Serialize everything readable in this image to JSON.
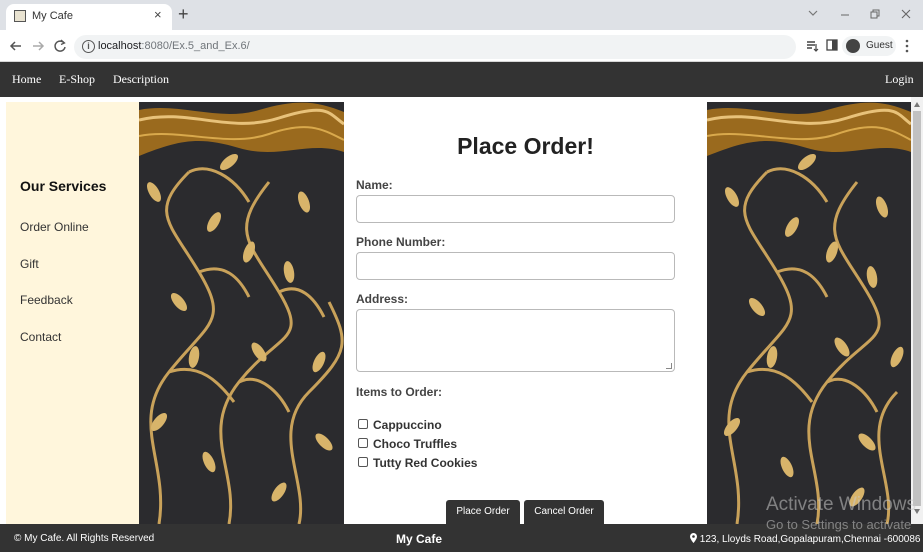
{
  "browser": {
    "tab_title": "My Cafe",
    "tab_close": "×",
    "new_tab": "+",
    "url_host": "localhost",
    "url_path": ":8080/Ex.5_and_Ex.6/",
    "profile_label": "Guest",
    "icons": {
      "back": "back-arrow-icon",
      "forward": "forward-arrow-icon",
      "reload": "reload-icon",
      "info": "info-icon",
      "reading_list": "reading-list-icon",
      "side_panel": "side-panel-icon",
      "menu": "kebab-menu-icon"
    }
  },
  "nav": {
    "links": [
      "Home",
      "E-Shop",
      "Description"
    ],
    "login": "Login"
  },
  "sidebar": {
    "heading": "Our Services",
    "items": [
      "Order Online",
      "Gift",
      "Feedback",
      "Contact"
    ]
  },
  "form": {
    "title": "Place Order!",
    "name_label": "Name:",
    "name_value": "",
    "phone_label": "Phone Number:",
    "phone_value": "",
    "address_label": "Address:",
    "address_value": "",
    "items_label": "Items to Order:",
    "items": [
      {
        "label": "Cappuccino",
        "checked": false
      },
      {
        "label": "Choco Truffles",
        "checked": false
      },
      {
        "label": "Tutty Red Cookies",
        "checked": false
      }
    ],
    "submit_label": "Place Order",
    "cancel_label": "Cancel Order"
  },
  "footer": {
    "copyright": "© My Cafe. All Rights Reserved",
    "brand": "My Cafe",
    "address": "123, Lloyds Road,Gopalapuram,Chennai -600086"
  },
  "os_watermark": {
    "line1": "Activate Windows",
    "line2": "Go to Settings to activate"
  },
  "colors": {
    "nav_bg": "#333333",
    "sidebar_bg": "#fff6dc",
    "pattern_bg": "#2a2a2c",
    "gold": "#c9a25a"
  }
}
